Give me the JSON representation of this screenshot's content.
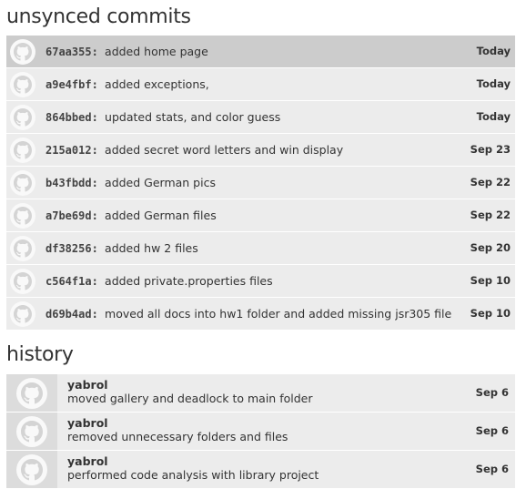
{
  "unsynced": {
    "title": "unsynced commits",
    "commits": [
      {
        "sha": "67aa355",
        "message": "added home page",
        "date": "Today",
        "selected": true
      },
      {
        "sha": "a9e4fbf",
        "message": "added exceptions,",
        "date": "Today"
      },
      {
        "sha": "864bbed",
        "message": "updated stats, and color guess",
        "date": "Today"
      },
      {
        "sha": "215a012",
        "message": "added secret word letters and win display",
        "date": "Sep 23"
      },
      {
        "sha": "b43fbdd",
        "message": "added German pics",
        "date": "Sep 22"
      },
      {
        "sha": "a7be69d",
        "message": "added German files",
        "date": "Sep 22"
      },
      {
        "sha": "df38256",
        "message": "added hw 2 files",
        "date": "Sep 20"
      },
      {
        "sha": "c564f1a",
        "message": "added private.properties files",
        "date": "Sep 10"
      },
      {
        "sha": "d69b4ad",
        "message": "moved all docs into hw1 folder and added missing jsr305 file",
        "date": "Sep 10"
      }
    ]
  },
  "history": {
    "title": "history",
    "commits": [
      {
        "author": "yabrol",
        "message": "moved gallery and deadlock to main folder",
        "date": "Sep 6"
      },
      {
        "author": "yabrol",
        "message": "removed unnecessary folders and files",
        "date": "Sep 6"
      },
      {
        "author": "yabrol",
        "message": "performed code analysis with library project",
        "date": "Sep 6"
      }
    ]
  },
  "icons": {
    "avatar": "github-octocat-icon"
  }
}
